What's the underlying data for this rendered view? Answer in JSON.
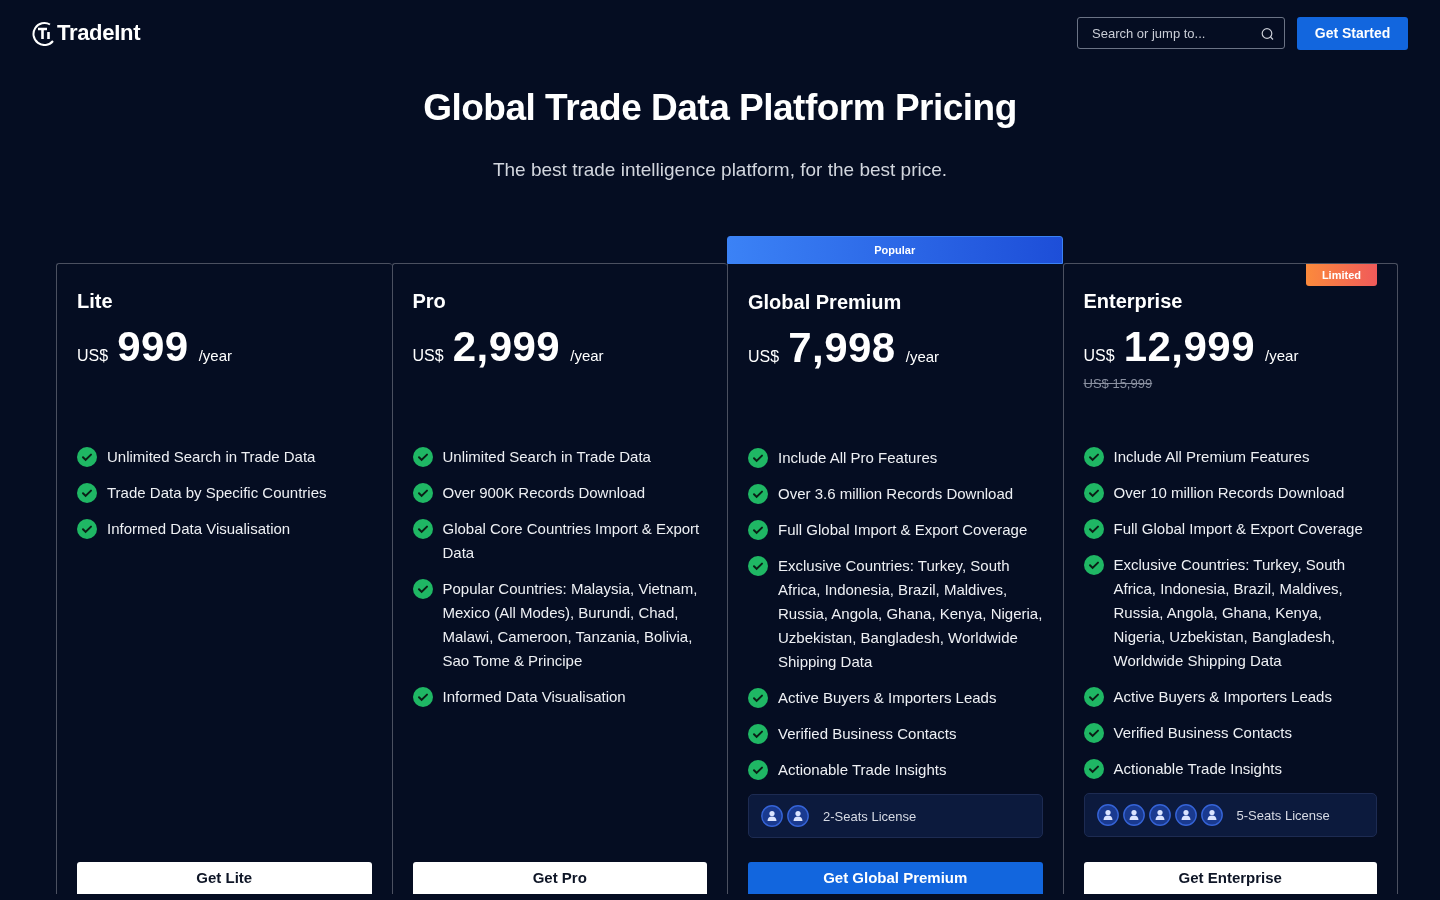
{
  "header": {
    "logo": "TradeInt",
    "search": {
      "placeholder": "Search or jump to..."
    },
    "cta": "Get Started"
  },
  "hero": {
    "title": "Global Trade Data Platform Pricing",
    "subtitle": "The best trade intelligence platform, for the best price."
  },
  "plans": [
    {
      "name": "Lite",
      "currency": "US$",
      "price": "999",
      "period": "/year",
      "features": [
        "Unlimited Search in Trade Data",
        "Trade Data by Specific Countries",
        "Informed Data Visualisation"
      ],
      "button": {
        "label": "Get Lite",
        "kind": "secondary"
      }
    },
    {
      "name": "Pro",
      "currency": "US$",
      "price": "2,999",
      "period": "/year",
      "features": [
        "Unlimited Search in Trade Data",
        "Over 900K Records Download",
        "Global Core Countries Import & Export Data",
        "Popular Countries: Malaysia, Vietnam, Mexico (All Modes), Burundi, Chad, Malawi, Cameroon, Tanzania, Bolivia, Sao Tome & Principe",
        "Informed Data Visualisation"
      ],
      "button": {
        "label": "Get Pro",
        "kind": "secondary"
      }
    },
    {
      "name": "Global Premium",
      "badge": {
        "text": "Popular",
        "kind": "banner"
      },
      "currency": "US$",
      "price": "7,998",
      "period": "/year",
      "features": [
        "Include All Pro Features",
        "Over 3.6 million Records Download",
        "Full Global Import & Export Coverage",
        "Exclusive Countries: Turkey, South Africa, Indonesia, Brazil, Maldives, Russia, Angola, Ghana, Kenya, Nigeria, Uzbekistan, Bangladesh, Worldwide Shipping Data",
        "Active Buyers & Importers Leads",
        "Verified Business Contacts",
        "Actionable Trade Insights"
      ],
      "seats": {
        "label": "2-Seats License",
        "icons": [
          {
            "kind": "person"
          },
          {
            "kind": "person"
          }
        ]
      },
      "button": {
        "label": "Get Global Premium",
        "kind": "primary"
      }
    },
    {
      "name": "Enterprise",
      "badge": {
        "text": "Limited",
        "kind": "tag"
      },
      "currency": "US$",
      "price": "12,999",
      "period": "/year",
      "old_price": "US$ 15,999",
      "features": [
        "Include All Premium Features",
        "Over 10 million Records Download",
        "Full Global Import & Export Coverage",
        "Exclusive Countries: Turkey, South Africa, Indonesia, Brazil, Maldives, Russia, Angola, Ghana, Kenya, Nigeria, Uzbekistan, Bangladesh, Worldwide Shipping Data",
        "Active Buyers & Importers Leads",
        "Verified Business Contacts",
        "Actionable Trade Insights"
      ],
      "seats": {
        "label": "5-Seats License",
        "icons": [
          {
            "kind": "person"
          },
          {
            "kind": "person"
          },
          {
            "kind": "person"
          },
          {
            "kind": "person"
          },
          {
            "kind": "person"
          }
        ]
      },
      "button": {
        "label": "Get Enterprise",
        "kind": "secondary"
      }
    }
  ]
}
